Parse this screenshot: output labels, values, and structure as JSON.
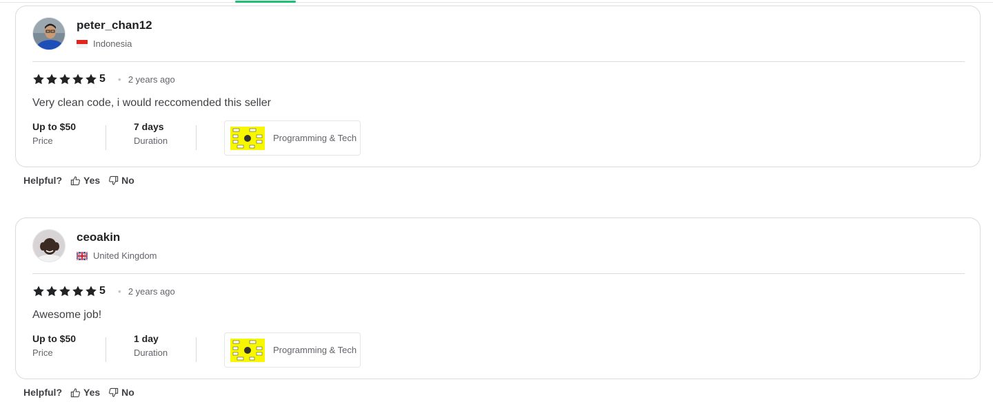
{
  "colors": {
    "accent": "#1dbf73",
    "star": "#222325",
    "border": "#dadbdd",
    "gig_thumb_bg": "#f7f700"
  },
  "reviews": [
    {
      "username": "peter_chan12",
      "country": "Indonesia",
      "flag_icon": "indonesia-flag-icon",
      "rating": "5",
      "stars": 5,
      "time_ago": "2 years ago",
      "text": "Very clean code, i would reccomended this seller",
      "price_value": "Up to $50",
      "price_label": "Price",
      "duration_value": "7 days",
      "duration_label": "Duration",
      "gig_category": "Programming & Tech",
      "helpful_label": "Helpful?",
      "yes_label": "Yes",
      "no_label": "No"
    },
    {
      "username": "ceoakin",
      "country": "United Kingdom",
      "flag_icon": "uk-flag-icon",
      "rating": "5",
      "stars": 5,
      "time_ago": "2 years ago",
      "text": "Awesome job!",
      "price_value": "Up to $50",
      "price_label": "Price",
      "duration_value": "1 day",
      "duration_label": "Duration",
      "gig_category": "Programming & Tech",
      "helpful_label": "Helpful?",
      "yes_label": "Yes",
      "no_label": "No"
    }
  ]
}
